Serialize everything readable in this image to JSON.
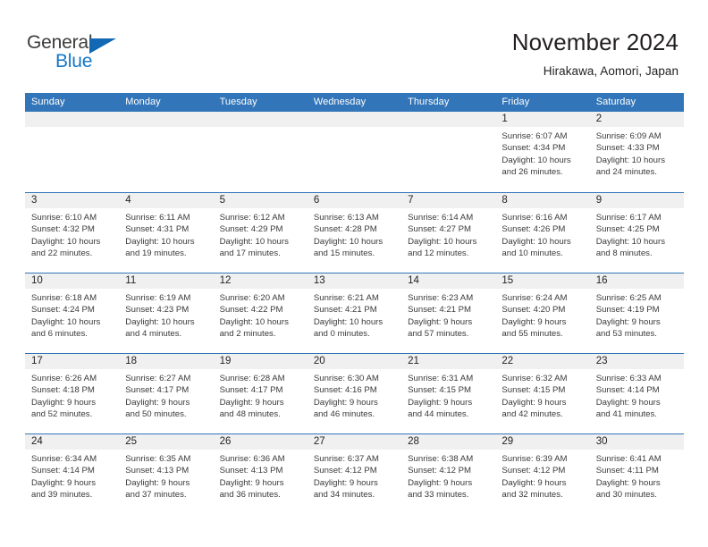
{
  "branding": {
    "word_one": "General",
    "word_two": "Blue",
    "accent_color": "#1577c6",
    "triangle_color": "#1268b3"
  },
  "header": {
    "title": "November 2024",
    "location": "Hirakawa, Aomori, Japan"
  },
  "theme": {
    "header_bg": "#3275b8",
    "header_text": "#ffffff",
    "day_band_bg": "#f0f0f0",
    "grid_line": "#3275b8",
    "body_text": "#231f20"
  },
  "weekdays": [
    "Sunday",
    "Monday",
    "Tuesday",
    "Wednesday",
    "Thursday",
    "Friday",
    "Saturday"
  ],
  "weeks": [
    [
      {
        "day": "",
        "lines": []
      },
      {
        "day": "",
        "lines": []
      },
      {
        "day": "",
        "lines": []
      },
      {
        "day": "",
        "lines": []
      },
      {
        "day": "",
        "lines": []
      },
      {
        "day": "1",
        "lines": [
          "Sunrise: 6:07 AM",
          "Sunset: 4:34 PM",
          "Daylight: 10 hours",
          "and 26 minutes."
        ]
      },
      {
        "day": "2",
        "lines": [
          "Sunrise: 6:09 AM",
          "Sunset: 4:33 PM",
          "Daylight: 10 hours",
          "and 24 minutes."
        ]
      }
    ],
    [
      {
        "day": "3",
        "lines": [
          "Sunrise: 6:10 AM",
          "Sunset: 4:32 PM",
          "Daylight: 10 hours",
          "and 22 minutes."
        ]
      },
      {
        "day": "4",
        "lines": [
          "Sunrise: 6:11 AM",
          "Sunset: 4:31 PM",
          "Daylight: 10 hours",
          "and 19 minutes."
        ]
      },
      {
        "day": "5",
        "lines": [
          "Sunrise: 6:12 AM",
          "Sunset: 4:29 PM",
          "Daylight: 10 hours",
          "and 17 minutes."
        ]
      },
      {
        "day": "6",
        "lines": [
          "Sunrise: 6:13 AM",
          "Sunset: 4:28 PM",
          "Daylight: 10 hours",
          "and 15 minutes."
        ]
      },
      {
        "day": "7",
        "lines": [
          "Sunrise: 6:14 AM",
          "Sunset: 4:27 PM",
          "Daylight: 10 hours",
          "and 12 minutes."
        ]
      },
      {
        "day": "8",
        "lines": [
          "Sunrise: 6:16 AM",
          "Sunset: 4:26 PM",
          "Daylight: 10 hours",
          "and 10 minutes."
        ]
      },
      {
        "day": "9",
        "lines": [
          "Sunrise: 6:17 AM",
          "Sunset: 4:25 PM",
          "Daylight: 10 hours",
          "and 8 minutes."
        ]
      }
    ],
    [
      {
        "day": "10",
        "lines": [
          "Sunrise: 6:18 AM",
          "Sunset: 4:24 PM",
          "Daylight: 10 hours",
          "and 6 minutes."
        ]
      },
      {
        "day": "11",
        "lines": [
          "Sunrise: 6:19 AM",
          "Sunset: 4:23 PM",
          "Daylight: 10 hours",
          "and 4 minutes."
        ]
      },
      {
        "day": "12",
        "lines": [
          "Sunrise: 6:20 AM",
          "Sunset: 4:22 PM",
          "Daylight: 10 hours",
          "and 2 minutes."
        ]
      },
      {
        "day": "13",
        "lines": [
          "Sunrise: 6:21 AM",
          "Sunset: 4:21 PM",
          "Daylight: 10 hours",
          "and 0 minutes."
        ]
      },
      {
        "day": "14",
        "lines": [
          "Sunrise: 6:23 AM",
          "Sunset: 4:21 PM",
          "Daylight: 9 hours",
          "and 57 minutes."
        ]
      },
      {
        "day": "15",
        "lines": [
          "Sunrise: 6:24 AM",
          "Sunset: 4:20 PM",
          "Daylight: 9 hours",
          "and 55 minutes."
        ]
      },
      {
        "day": "16",
        "lines": [
          "Sunrise: 6:25 AM",
          "Sunset: 4:19 PM",
          "Daylight: 9 hours",
          "and 53 minutes."
        ]
      }
    ],
    [
      {
        "day": "17",
        "lines": [
          "Sunrise: 6:26 AM",
          "Sunset: 4:18 PM",
          "Daylight: 9 hours",
          "and 52 minutes."
        ]
      },
      {
        "day": "18",
        "lines": [
          "Sunrise: 6:27 AM",
          "Sunset: 4:17 PM",
          "Daylight: 9 hours",
          "and 50 minutes."
        ]
      },
      {
        "day": "19",
        "lines": [
          "Sunrise: 6:28 AM",
          "Sunset: 4:17 PM",
          "Daylight: 9 hours",
          "and 48 minutes."
        ]
      },
      {
        "day": "20",
        "lines": [
          "Sunrise: 6:30 AM",
          "Sunset: 4:16 PM",
          "Daylight: 9 hours",
          "and 46 minutes."
        ]
      },
      {
        "day": "21",
        "lines": [
          "Sunrise: 6:31 AM",
          "Sunset: 4:15 PM",
          "Daylight: 9 hours",
          "and 44 minutes."
        ]
      },
      {
        "day": "22",
        "lines": [
          "Sunrise: 6:32 AM",
          "Sunset: 4:15 PM",
          "Daylight: 9 hours",
          "and 42 minutes."
        ]
      },
      {
        "day": "23",
        "lines": [
          "Sunrise: 6:33 AM",
          "Sunset: 4:14 PM",
          "Daylight: 9 hours",
          "and 41 minutes."
        ]
      }
    ],
    [
      {
        "day": "24",
        "lines": [
          "Sunrise: 6:34 AM",
          "Sunset: 4:14 PM",
          "Daylight: 9 hours",
          "and 39 minutes."
        ]
      },
      {
        "day": "25",
        "lines": [
          "Sunrise: 6:35 AM",
          "Sunset: 4:13 PM",
          "Daylight: 9 hours",
          "and 37 minutes."
        ]
      },
      {
        "day": "26",
        "lines": [
          "Sunrise: 6:36 AM",
          "Sunset: 4:13 PM",
          "Daylight: 9 hours",
          "and 36 minutes."
        ]
      },
      {
        "day": "27",
        "lines": [
          "Sunrise: 6:37 AM",
          "Sunset: 4:12 PM",
          "Daylight: 9 hours",
          "and 34 minutes."
        ]
      },
      {
        "day": "28",
        "lines": [
          "Sunrise: 6:38 AM",
          "Sunset: 4:12 PM",
          "Daylight: 9 hours",
          "and 33 minutes."
        ]
      },
      {
        "day": "29",
        "lines": [
          "Sunrise: 6:39 AM",
          "Sunset: 4:12 PM",
          "Daylight: 9 hours",
          "and 32 minutes."
        ]
      },
      {
        "day": "30",
        "lines": [
          "Sunrise: 6:41 AM",
          "Sunset: 4:11 PM",
          "Daylight: 9 hours",
          "and 30 minutes."
        ]
      }
    ]
  ]
}
